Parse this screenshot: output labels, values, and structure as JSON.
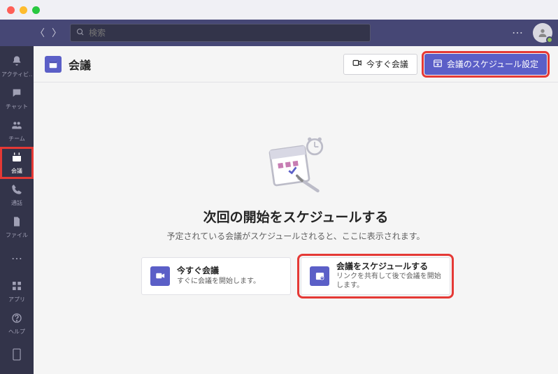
{
  "search": {
    "placeholder": "検索"
  },
  "rail": {
    "items": [
      {
        "label": "アクティビ…"
      },
      {
        "label": "チャット"
      },
      {
        "label": "チーム"
      },
      {
        "label": "会議"
      },
      {
        "label": "通話"
      },
      {
        "label": "ファイル"
      }
    ],
    "more": "…",
    "apps": "アプリ",
    "help": "ヘルプ"
  },
  "header": {
    "title": "会議",
    "meet_now": "今すぐ会議",
    "schedule": "会議のスケジュール設定"
  },
  "content": {
    "heading": "次回の開始をスケジュールする",
    "sub": "予定されている会議がスケジュールされると、ここに表示されます。",
    "cards": [
      {
        "title": "今すぐ会議",
        "sub": "すぐに会議を開始します。"
      },
      {
        "title": "会議をスケジュールする",
        "sub": "リンクを共有して後で会議を開始します。"
      }
    ]
  }
}
